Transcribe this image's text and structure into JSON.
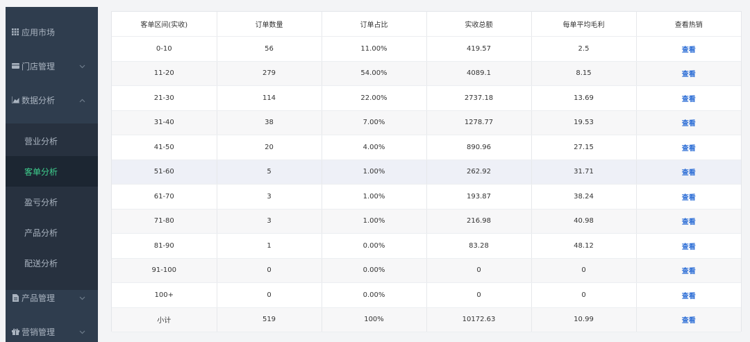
{
  "sidebar": {
    "items": [
      {
        "label": "应用市场",
        "icon": "grid-icon"
      },
      {
        "label": "门店管理",
        "icon": "store-icon",
        "chevron": "chevron-down-icon"
      },
      {
        "label": "数据分析",
        "icon": "chart-icon",
        "chevron": "chevron-up-icon"
      },
      {
        "label": "产品管理",
        "icon": "document-icon",
        "chevron": "chevron-down-icon"
      },
      {
        "label": "营销管理",
        "icon": "gift-icon",
        "chevron": "chevron-down-icon"
      }
    ],
    "sub_items": [
      {
        "label": "营业分析"
      },
      {
        "label": "客单分析",
        "active": true
      },
      {
        "label": "盈亏分析"
      },
      {
        "label": "产品分析"
      },
      {
        "label": "配送分析"
      }
    ]
  },
  "table": {
    "headers": [
      "客单区间(实收)",
      "订单数量",
      "订单占比",
      "实收总额",
      "每单平均毛利",
      "查看热销"
    ],
    "rows": [
      [
        "0-10",
        "56",
        "11.00%",
        "419.57",
        "2.5",
        "查看"
      ],
      [
        "11-20",
        "279",
        "54.00%",
        "4089.1",
        "8.15",
        "查看"
      ],
      [
        "21-30",
        "114",
        "22.00%",
        "2737.18",
        "13.69",
        "查看"
      ],
      [
        "31-40",
        "38",
        "7.00%",
        "1278.77",
        "19.53",
        "查看"
      ],
      [
        "41-50",
        "20",
        "4.00%",
        "890.96",
        "27.15",
        "查看"
      ],
      [
        "51-60",
        "5",
        "1.00%",
        "262.92",
        "31.71",
        "查看"
      ],
      [
        "61-70",
        "3",
        "1.00%",
        "193.87",
        "38.24",
        "查看"
      ],
      [
        "71-80",
        "3",
        "1.00%",
        "216.98",
        "40.98",
        "查看"
      ],
      [
        "81-90",
        "1",
        "0.00%",
        "83.28",
        "48.12",
        "查看"
      ],
      [
        "91-100",
        "0",
        "0.00%",
        "0",
        "0",
        "查看"
      ],
      [
        "100+",
        "0",
        "0.00%",
        "0",
        "0",
        "查看"
      ],
      [
        "小计",
        "519",
        "100%",
        "10172.63",
        "10.99",
        "查看"
      ]
    ]
  },
  "colors": {
    "sidebar_bg": "#2f3d4e",
    "active_text": "#3fd08e",
    "link": "#2f6fd6"
  }
}
